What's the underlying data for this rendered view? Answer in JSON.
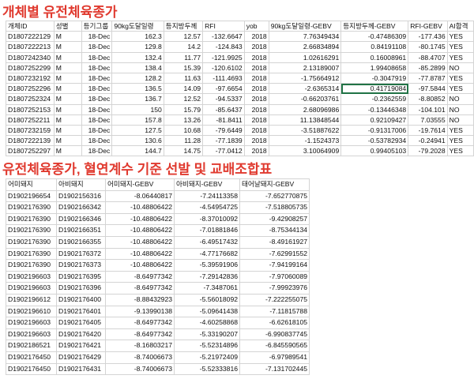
{
  "title1": "개체별 유전체육종가",
  "title2": "유전체육종가, 혈연계수 기준 선발 및 교배조합표",
  "table1": {
    "headers": [
      "개체ID",
      "성별",
      "등기그룹",
      "90kg도달일령",
      "등지방두께",
      "RFI",
      "yob",
      "90kg도달일령-GEBV",
      "등지방두께-GEBV",
      "RFI-GEBV",
      "AI합격"
    ],
    "rows": [
      [
        "D1807222129",
        "M",
        "18-Dec",
        "162.3",
        "12.57",
        "-132.6647",
        "2018",
        "7.76349434",
        "-0.47486309",
        "-177.436",
        "YES"
      ],
      [
        "D1807222213",
        "M",
        "18-Dec",
        "129.8",
        "14.2",
        "-124.843",
        "2018",
        "2.66834894",
        "0.84191108",
        "-80.1745",
        "YES"
      ],
      [
        "D1807242340",
        "M",
        "18-Dec",
        "132.4",
        "11.77",
        "-121.9925",
        "2018",
        "1.02616291",
        "0.16008961",
        "-88.4707",
        "YES"
      ],
      [
        "D1807252299",
        "M",
        "18-Dec",
        "138.4",
        "15.39",
        "-120.6102",
        "2018",
        "2.13189007",
        "1.99408658",
        "-85.2899",
        "NO"
      ],
      [
        "D1807232192",
        "M",
        "18-Dec",
        "128.2",
        "11.63",
        "-111.4693",
        "2018",
        "-1.75664912",
        "-0.3047919",
        "-77.8787",
        "YES"
      ],
      [
        "D1807252296",
        "M",
        "18-Dec",
        "136.5",
        "14.09",
        "-97.6654",
        "2018",
        "-2.6365314",
        "0.41719084",
        "-97.5844",
        "YES"
      ],
      [
        "D1807252324",
        "M",
        "18-Dec",
        "136.7",
        "12.52",
        "-94.5337",
        "2018",
        "-0.66203761",
        "-0.2362559",
        "-8.80852",
        "NO"
      ],
      [
        "D1807252153",
        "M",
        "18-Dec",
        "150",
        "15.79",
        "-85.6437",
        "2018",
        "2.68096986",
        "-0.13446348",
        "-104.101",
        "NO"
      ],
      [
        "D1807252211",
        "M",
        "18-Dec",
        "157.8",
        "13.26",
        "-81.8411",
        "2018",
        "11.13848544",
        "0.92109427",
        "7.03555",
        "NO"
      ],
      [
        "D1807232159",
        "M",
        "18-Dec",
        "127.5",
        "10.68",
        "-79.6449",
        "2018",
        "-3.51887622",
        "-0.91317006",
        "-19.7614",
        "YES"
      ],
      [
        "D1807222139",
        "M",
        "18-Dec",
        "130.6",
        "11.28",
        "-77.1839",
        "2018",
        "-1.1524373",
        "-0.53782934",
        "-0.24941",
        "YES"
      ],
      [
        "D1807252297",
        "M",
        "18-Dec",
        "144.7",
        "14.75",
        "-77.0412",
        "2018",
        "3.10064909",
        "0.99405103",
        "-79.2028",
        "YES"
      ]
    ]
  },
  "table2": {
    "headers": [
      "어미돼지",
      "아비돼지",
      "어미돼지-GEBV",
      "아비돼지-GEBV",
      "태어날돼지-GEBV"
    ],
    "rows": [
      [
        "D1902196654",
        "D1902156316",
        "-8.06440817",
        "-7.24113358",
        "-7.652770875"
      ],
      [
        "D1902176390",
        "D1902166342",
        "-10.48806422",
        "-4.54954725",
        "-7.518805735"
      ],
      [
        "D1902176390",
        "D1902166346",
        "-10.48806422",
        "-8.37010092",
        "-9.42908257"
      ],
      [
        "D1902176390",
        "D1902166351",
        "-10.48806422",
        "-7.01881846",
        "-8.75344134"
      ],
      [
        "D1902176390",
        "D1902166355",
        "-10.48806422",
        "-6.49517432",
        "-8.49161927"
      ],
      [
        "D1902176390",
        "D1902176372",
        "-10.48806422",
        "-4.77176682",
        "-7.62991552"
      ],
      [
        "D1902176390",
        "D1902176373",
        "-10.48806422",
        "-5.39591906",
        "-7.94199164"
      ],
      [
        "D1902196603",
        "D1902176395",
        "-8.64977342",
        "-7.29142836",
        "-7.97060089"
      ],
      [
        "D1902196603",
        "D1902176396",
        "-8.64977342",
        "-7.3487061",
        "-7.99923976"
      ],
      [
        "D1902196612",
        "D1902176400",
        "-8.88432923",
        "-5.56018092",
        "-7.222255075"
      ],
      [
        "D1902196610",
        "D1902176401",
        "-9.13990138",
        "-5.09641438",
        "-7.11815788"
      ],
      [
        "D1902196603",
        "D1902176405",
        "-8.64977342",
        "-4.60258868",
        "-6.62618105"
      ],
      [
        "D1902196603",
        "D1902176420",
        "-8.64977342",
        "-5.33190207",
        "-6.990837745"
      ],
      [
        "D1902186521",
        "D1902176421",
        "-8.16803217",
        "-5.52314896",
        "-6.845590565"
      ],
      [
        "D1902176450",
        "D1902176429",
        "-8.74006673",
        "-5.21972409",
        "-6.97989541"
      ],
      [
        "D1902176450",
        "D1902176431",
        "-8.74006673",
        "-5.52333816",
        "-7.131702445"
      ]
    ]
  }
}
